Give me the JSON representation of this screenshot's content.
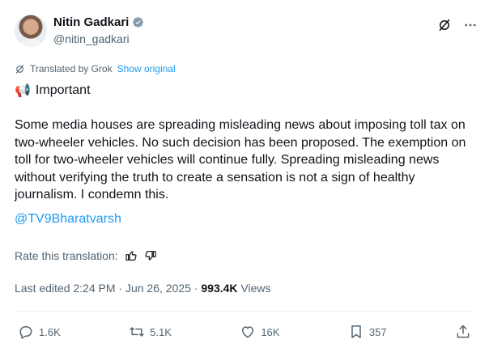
{
  "author": {
    "name": "Nitin Gadkari",
    "handle": "@nitin_gadkari",
    "verified": true
  },
  "translation": {
    "label": "Translated by Grok",
    "show_original": "Show original"
  },
  "post": {
    "title_emoji": "📢",
    "title": "Important",
    "body": "Some media houses are spreading misleading news about imposing toll tax on two-wheeler vehicles. No such decision has been proposed. The exemption on toll for two-wheeler vehicles will continue fully. Spreading misleading news without verifying the truth to create a sensation is not a sign of healthy journalism. I condemn this.",
    "mention": "@TV9Bharatvarsh"
  },
  "rate": {
    "label": "Rate this translation:"
  },
  "meta": {
    "edited": "Last edited 2:24 PM · Jun 26, 2025 · ",
    "views_count": "993.4K",
    "views_label": " Views"
  },
  "actions": {
    "replies": "1.6K",
    "reposts": "5.1K",
    "likes": "16K",
    "bookmarks": "357"
  },
  "colors": {
    "accent": "#1d9bf0",
    "muted": "#536471",
    "text": "#0f1419"
  }
}
